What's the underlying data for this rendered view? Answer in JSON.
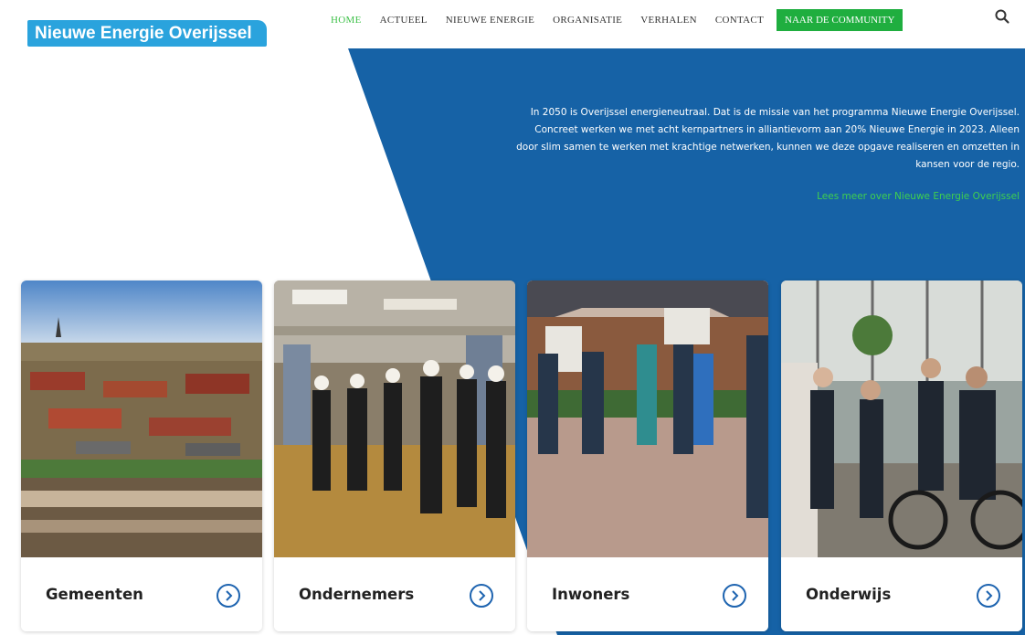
{
  "header": {
    "logo_text": "Nieuwe Energie Overijssel",
    "nav": [
      {
        "label": "HOME",
        "active": true
      },
      {
        "label": "ACTUEEL",
        "active": false
      },
      {
        "label": "NIEUWE ENERGIE",
        "active": false
      },
      {
        "label": "ORGANISATIE",
        "active": false
      },
      {
        "label": "VERHALEN",
        "active": false
      },
      {
        "label": "CONTACT",
        "active": false
      }
    ],
    "cta_label": "NAAR DE COMMUNITY",
    "search_icon": "search-icon"
  },
  "hero": {
    "text": "In 2050 is Overijssel energieneutraal. Dat is de missie van het programma Nieuwe Energie Overijssel. Concreet werken we met acht kernpartners in alliantievorm aan 20% Nieuwe Energie in 2023. Alleen door slim samen te werken met krachtige netwerken, kunnen we deze opgave realiseren en omzetten in kansen voor de regio.",
    "link_text": "Lees meer over Nieuwe Energie Overijssel"
  },
  "cards": [
    {
      "label": "Gemeenten",
      "image": "aerial-village-photo",
      "icon": "chevron-right-circle-icon"
    },
    {
      "label": "Ondernemers",
      "image": "factory-visit-photo",
      "icon": "chevron-right-circle-icon"
    },
    {
      "label": "Inwoners",
      "image": "street-group-photo",
      "icon": "chevron-right-circle-icon"
    },
    {
      "label": "Onderwijs",
      "image": "students-bike-photo",
      "icon": "chevron-right-circle-icon"
    }
  ],
  "colors": {
    "brand_blue": "#1662a6",
    "logo_blue": "#2aa3dd",
    "accent_green": "#1fae3f",
    "link_green": "#3fd04f",
    "icon_blue": "#1e64b0"
  }
}
